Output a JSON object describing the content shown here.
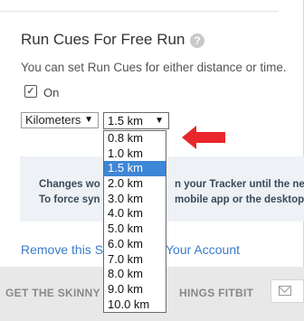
{
  "section": {
    "title": "Run Cues For Free Run",
    "help_icon": "?",
    "description": "You can set Run Cues for either distance or time.",
    "checkbox_label": "On",
    "checkbox_checked": true
  },
  "controls": {
    "unit_selected": "Kilometers",
    "distance_selected": "1.5 km",
    "arrow_glyph": "▼"
  },
  "dropdown": {
    "options": [
      "0.8 km",
      "1.0 km",
      "1.5 km",
      "2.0 km",
      "3.0 km",
      "4.0 km",
      "5.0 km",
      "6.0 km",
      "7.0 km",
      "8.0 km",
      "9.0 km",
      "10.0 km"
    ],
    "selected_index": 2
  },
  "info": {
    "line1_a": "Changes wo",
    "line1_b": "n your Tracker until the nex",
    "line2_a": "To force syn",
    "line2_b": "mobile app or the desktop c"
  },
  "links": {
    "remove_a": "Remove this S",
    "remove_b": "Your Account"
  },
  "footer": {
    "text_a": "GET THE SKINNY",
    "text_b": "HINGS FITBIT"
  },
  "colors": {
    "accent": "#3e86d6",
    "link": "#3b7bc8",
    "annotation_arrow": "#e8262b"
  },
  "icons": {
    "help": "help-icon",
    "email": "email-icon",
    "annotation": "red-arrow-icon"
  }
}
